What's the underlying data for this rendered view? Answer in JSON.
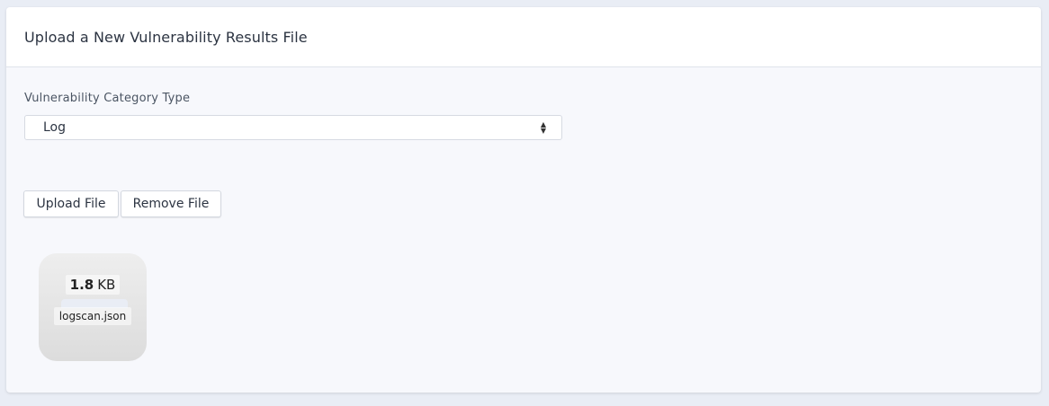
{
  "header": {
    "title": "Upload a New Vulnerability Results File"
  },
  "form": {
    "category_label": "Vulnerability Category Type",
    "category_selected": "Log"
  },
  "buttons": {
    "upload_label": "Upload File",
    "remove_label": "Remove File"
  },
  "file": {
    "size_value": "1.8",
    "size_unit": "KB",
    "name": "logscan.json"
  },
  "icons": {
    "select_arrows": "sort-updown-icon"
  }
}
